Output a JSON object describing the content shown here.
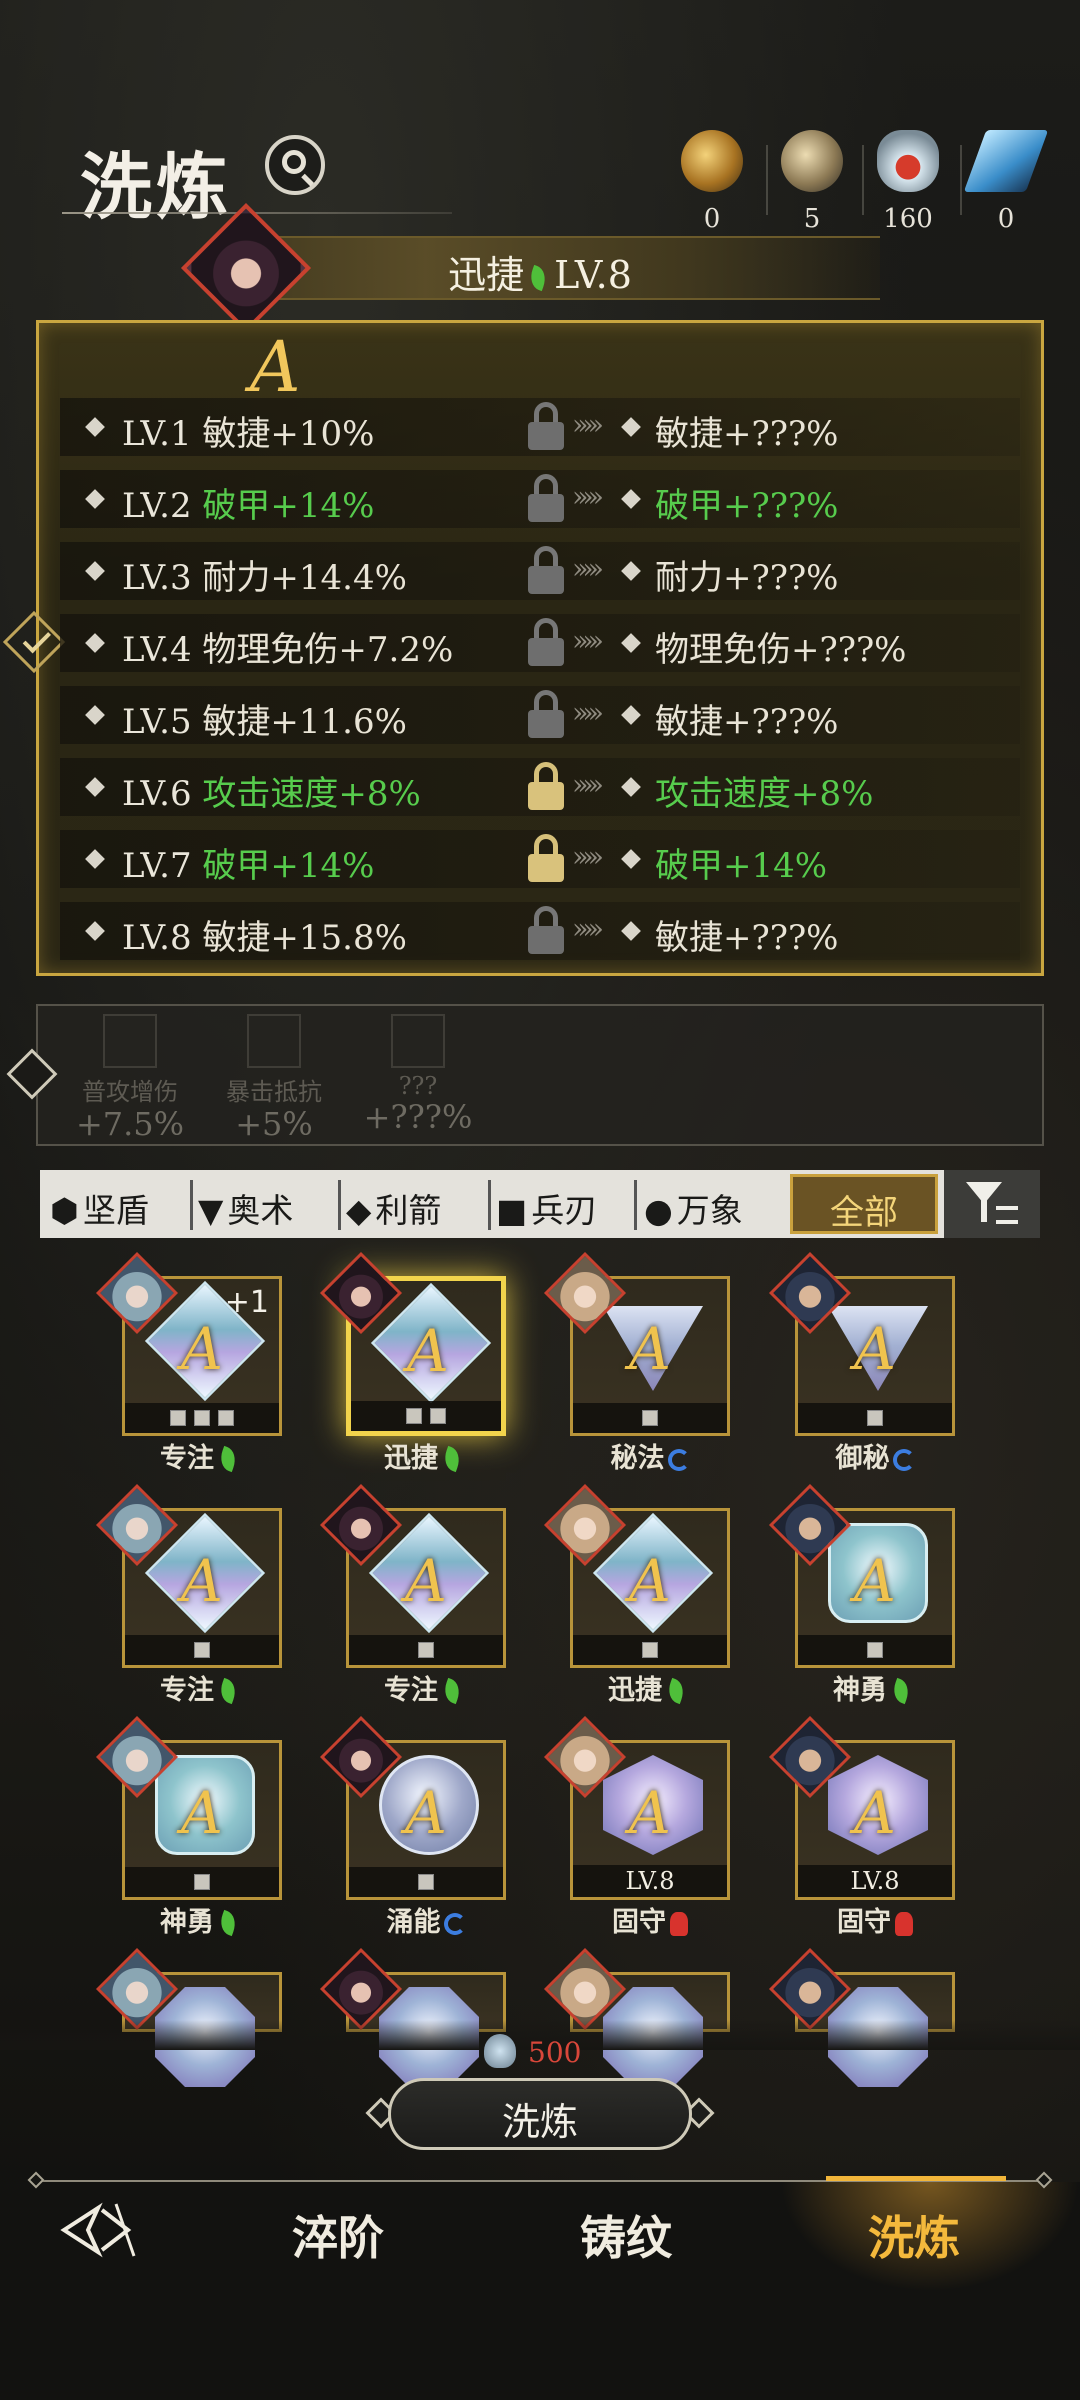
{
  "header": {
    "title": "洗炼",
    "resources": [
      {
        "icon": "gold-orb-icon",
        "value": "0"
      },
      {
        "icon": "stone-orb-icon",
        "value": "5"
      },
      {
        "icon": "potion-flask-icon",
        "value": "160"
      },
      {
        "icon": "crystal-shard-icon",
        "value": "0"
      }
    ]
  },
  "item": {
    "name": "迅捷",
    "level": "LV.8",
    "grade": "A"
  },
  "stats": [
    {
      "lv": "LV.1",
      "attr": "敏捷+10%",
      "green": false,
      "locked": false,
      "result": "敏捷+???%"
    },
    {
      "lv": "LV.2",
      "attr": "破甲+14%",
      "green": true,
      "locked": false,
      "result": "破甲+???%"
    },
    {
      "lv": "LV.3",
      "attr": "耐力+14.4%",
      "green": false,
      "locked": false,
      "result": "耐力+???%"
    },
    {
      "lv": "LV.4",
      "attr": "物理免伤+7.2%",
      "green": false,
      "locked": false,
      "result": "物理免伤+???%"
    },
    {
      "lv": "LV.5",
      "attr": "敏捷+11.6%",
      "green": false,
      "locked": false,
      "result": "敏捷+???%"
    },
    {
      "lv": "LV.6",
      "attr": "攻击速度+8%",
      "green": true,
      "locked": true,
      "result": "攻击速度+8%"
    },
    {
      "lv": "LV.7",
      "attr": "破甲+14%",
      "green": true,
      "locked": true,
      "result": "破甲+14%"
    },
    {
      "lv": "LV.8",
      "attr": "敏捷+15.8%",
      "green": false,
      "locked": false,
      "result": "敏捷+???%"
    }
  ],
  "arrows": "›››››",
  "bonus": [
    {
      "name": "普攻增伤",
      "value": "+7.5%"
    },
    {
      "name": "暴击抵抗",
      "value": "+5%"
    },
    {
      "name": "???",
      "value": "+???%"
    }
  ],
  "filters": [
    {
      "sym": "⬢",
      "label": "坚盾"
    },
    {
      "sym": "▼",
      "label": "奥术"
    },
    {
      "sym": "◆",
      "label": "利箭"
    },
    {
      "sym": "■",
      "label": "兵刃"
    },
    {
      "sym": "●",
      "label": "万象"
    }
  ],
  "filter_all": "全部",
  "gems": [
    {
      "name": "专注",
      "shape": "diamond",
      "slots": 3,
      "plus": "+1",
      "badge": "leaf",
      "level": ""
    },
    {
      "name": "迅捷",
      "shape": "diamond",
      "slots": 2,
      "plus": "",
      "badge": "leaf",
      "level": ""
    },
    {
      "name": "秘法",
      "shape": "tri",
      "slots": 1,
      "plus": "",
      "badge": "swirl",
      "level": ""
    },
    {
      "name": "御秘",
      "shape": "tri",
      "slots": 1,
      "plus": "",
      "badge": "swirl",
      "level": ""
    },
    {
      "name": "专注",
      "shape": "diamond",
      "slots": 1,
      "plus": "",
      "badge": "leaf",
      "level": ""
    },
    {
      "name": "专注",
      "shape": "diamond",
      "slots": 1,
      "plus": "",
      "badge": "leaf",
      "level": ""
    },
    {
      "name": "迅捷",
      "shape": "diamond",
      "slots": 1,
      "plus": "",
      "badge": "leaf",
      "level": ""
    },
    {
      "name": "神勇",
      "shape": "cushion",
      "slots": 1,
      "plus": "",
      "badge": "leaf",
      "level": ""
    },
    {
      "name": "神勇",
      "shape": "cushion",
      "slots": 1,
      "plus": "",
      "badge": "leaf",
      "level": ""
    },
    {
      "name": "涌能",
      "shape": "round",
      "slots": 1,
      "plus": "",
      "badge": "swirl",
      "level": ""
    },
    {
      "name": "固守",
      "shape": "hex",
      "slots": 0,
      "plus": "",
      "badge": "claw",
      "level": "LV.8"
    },
    {
      "name": "固守",
      "shape": "hex",
      "slots": 0,
      "plus": "",
      "badge": "claw",
      "level": "LV.8"
    },
    {
      "name": "",
      "shape": "octa",
      "slots": 0,
      "plus": "",
      "badge": "",
      "level": ""
    },
    {
      "name": "",
      "shape": "octa",
      "slots": 0,
      "plus": "",
      "badge": "",
      "level": ""
    },
    {
      "name": "",
      "shape": "octa",
      "slots": 0,
      "plus": "",
      "badge": "",
      "level": ""
    },
    {
      "name": "",
      "shape": "octa",
      "slots": 0,
      "plus": "",
      "badge": "",
      "level": ""
    }
  ],
  "action": {
    "cost": "500",
    "cost_icon": "potion-flask-icon",
    "button_label": "洗炼"
  },
  "nav": {
    "back_icon": "back-arrow-icon",
    "items": [
      "淬阶",
      "铸纹",
      "洗炼"
    ],
    "active": "洗炼"
  },
  "colors": {
    "accent_gold": "#c9a640",
    "stat_green": "#57cc4d",
    "nav_active": "#f4b93c",
    "cost_red": "#d9473a"
  }
}
